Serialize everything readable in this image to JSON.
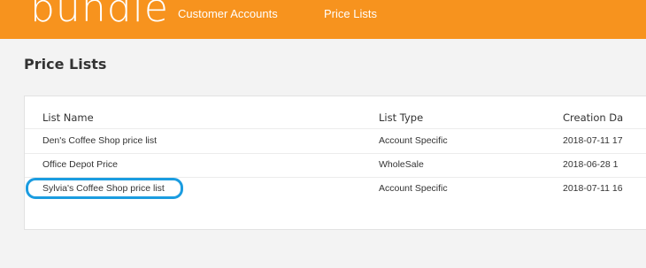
{
  "header": {
    "logo_text": "bundle",
    "nav": [
      {
        "label": "Customer Accounts"
      },
      {
        "label": "Price Lists"
      }
    ],
    "color": "#f7931e"
  },
  "page": {
    "title": "Price Lists"
  },
  "table": {
    "columns": [
      "List Name",
      "List Type",
      "Creation Da"
    ],
    "rows": [
      {
        "name": "Den's Coffee Shop price list",
        "type": "Account Specific",
        "date": "2018-07-11 17"
      },
      {
        "name": "Office Depot Price",
        "type": "WholeSale",
        "date": "2018-06-28 1"
      },
      {
        "name": "Sylvia's Coffee Shop price list",
        "type": "Account Specific",
        "date": "2018-07-11 16"
      }
    ]
  },
  "highlight": {
    "color": "#1b9ce0",
    "target": "Sylvia's Coffee Shop price list"
  }
}
